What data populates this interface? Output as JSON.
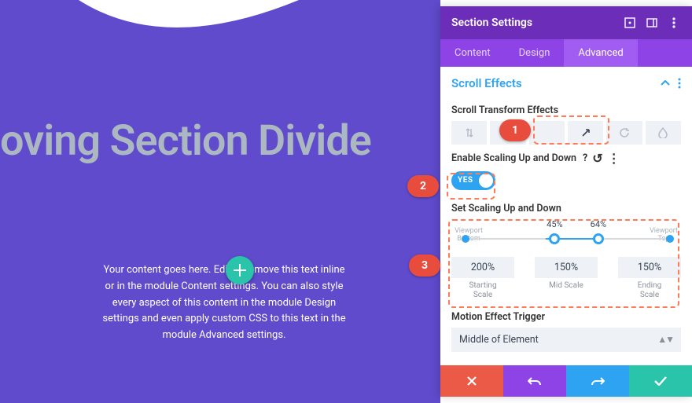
{
  "stage": {
    "headline": "oving Section Divide",
    "body": "Your content goes here. Edit or remove this text inline or in the module Content settings. You can also style every aspect of this content in the module Design settings and even apply custom CSS to this text in the module Advanced settings."
  },
  "panel": {
    "title": "Section Settings",
    "tabs": {
      "content": "Content",
      "design": "Design",
      "advanced": "Advanced"
    },
    "active_tab": "Advanced"
  },
  "section": {
    "title": "Scroll Effects",
    "transform_label": "Scroll Transform Effects",
    "enable_label": "Enable Scaling Up and Down",
    "toggle_value": "YES",
    "set_label": "Set Scaling Up and Down",
    "slider": {
      "pct_left": "45%",
      "pct_right": "64%",
      "vp_bottom": "Viewport Bottom",
      "vp_top": "Viewport Top"
    },
    "scales": {
      "start": {
        "value": "200%",
        "name": "Starting\nScale"
      },
      "mid": {
        "value": "150%",
        "name": "Mid Scale"
      },
      "end": {
        "value": "150%",
        "name": "Ending\nScale"
      }
    },
    "trigger_label": "Motion Effect Trigger",
    "trigger_value": "Middle of Element"
  },
  "callouts": {
    "n1": "1",
    "n2": "2",
    "n3": "3"
  }
}
